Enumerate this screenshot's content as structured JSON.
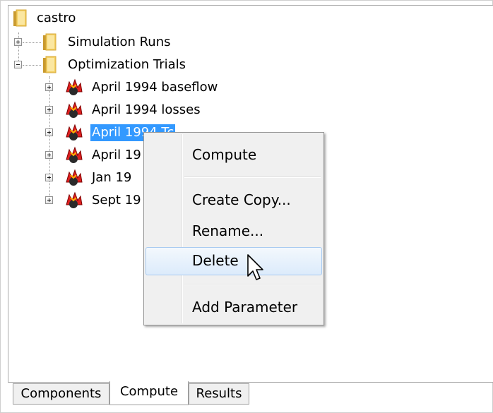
{
  "tree": {
    "root": {
      "label": "castro",
      "icon": "folder-icon"
    },
    "groups": [
      {
        "label": "Simulation Runs",
        "expanded": false,
        "icon": "folder-icon"
      },
      {
        "label": "Optimization Trials",
        "expanded": true,
        "icon": "folder-icon"
      }
    ],
    "trials": [
      {
        "label": "April 1994 baseflow",
        "icon": "optimization-trial-icon"
      },
      {
        "label": "April 1994 losses",
        "icon": "optimization-trial-icon"
      },
      {
        "label": "April 1994 Tc",
        "icon": "optimization-trial-icon",
        "selected": true
      },
      {
        "label": "April 19",
        "icon": "optimization-trial-icon"
      },
      {
        "label": "Jan 19",
        "icon": "optimization-trial-icon"
      },
      {
        "label": "Sept 19",
        "icon": "optimization-trial-icon"
      }
    ]
  },
  "context_menu": {
    "items": [
      {
        "label": "Compute"
      },
      {
        "label": "Create Copy..."
      },
      {
        "label": "Rename..."
      },
      {
        "label": "Delete",
        "highlighted": true
      },
      {
        "label": "Add Parameter"
      }
    ]
  },
  "tabs": [
    {
      "label": "Components",
      "active": false
    },
    {
      "label": "Compute",
      "active": true
    },
    {
      "label": "Results",
      "active": false
    }
  ],
  "colors": {
    "selection": "#3399ff",
    "menu_hover_border": "#a8caf0"
  }
}
